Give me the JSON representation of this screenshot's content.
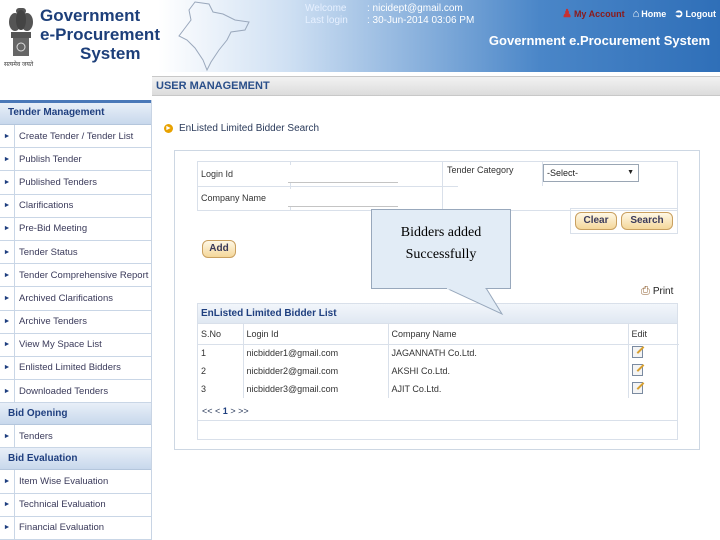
{
  "header": {
    "emblem_caption": "सत्यमेव जयते",
    "logo_line1": "Government",
    "logo_line2": "e-Procurement",
    "logo_line3": "System",
    "welcome_label": "Welcome",
    "welcome_value": ":  nicidept@gmail.com",
    "lastlogin_label": "Last login",
    "lastlogin_value": ":  30-Jun-2014  03:06 PM",
    "links": {
      "my_account": "My Account",
      "home": "Home",
      "logout": "Logout"
    },
    "system_title": "Government e.Procurement System"
  },
  "section_title": "USER MANAGEMENT",
  "sidebar": {
    "groups": [
      {
        "title": "Tender Management",
        "items": [
          "Create Tender / Tender List",
          "Publish Tender",
          "Published Tenders",
          "Clarifications",
          "Pre-Bid Meeting",
          "Tender Status",
          "Tender Comprehensive Report",
          "Archived Clarifications",
          "Archive Tenders",
          "View My Space List",
          "Enlisted Limited Bidders",
          "Downloaded Tenders"
        ]
      },
      {
        "title": "Bid Opening",
        "items": [
          "Tenders"
        ]
      },
      {
        "title": "Bid Evaluation",
        "items": [
          "Item Wise Evaluation",
          "Technical Evaluation",
          "Financial Evaluation"
        ]
      }
    ]
  },
  "breadcrumb": "EnListed Limited Bidder Search",
  "form": {
    "login_id_label": "Login Id",
    "login_id_value": "",
    "company_name_label": "Company Name",
    "company_name_value": "",
    "tender_category_label": "Tender Category",
    "tender_category_selected": "-Select-",
    "clear_label": "Clear",
    "search_label": "Search",
    "add_label": "Add"
  },
  "print_label": "Print",
  "list": {
    "title": "EnListed Limited Bidder List",
    "columns": [
      "S.No",
      "Login Id",
      "Company Name",
      "Edit"
    ],
    "rows": [
      {
        "sno": "1",
        "login": "nicbidder1@gmail.com",
        "company": "JAGANNATH Co.Ltd."
      },
      {
        "sno": "2",
        "login": "nicbidder2@gmail.com",
        "company": "AKSHI Co.Ltd."
      },
      {
        "sno": "3",
        "login": "nicbidder3@gmail.com",
        "company": "AJIT Co.Ltd."
      }
    ],
    "pager_prev": "<< <",
    "pager_page": "1",
    "pager_next": "> >>"
  },
  "callout": {
    "line1": "Bidders added",
    "line2": "Successfully"
  }
}
